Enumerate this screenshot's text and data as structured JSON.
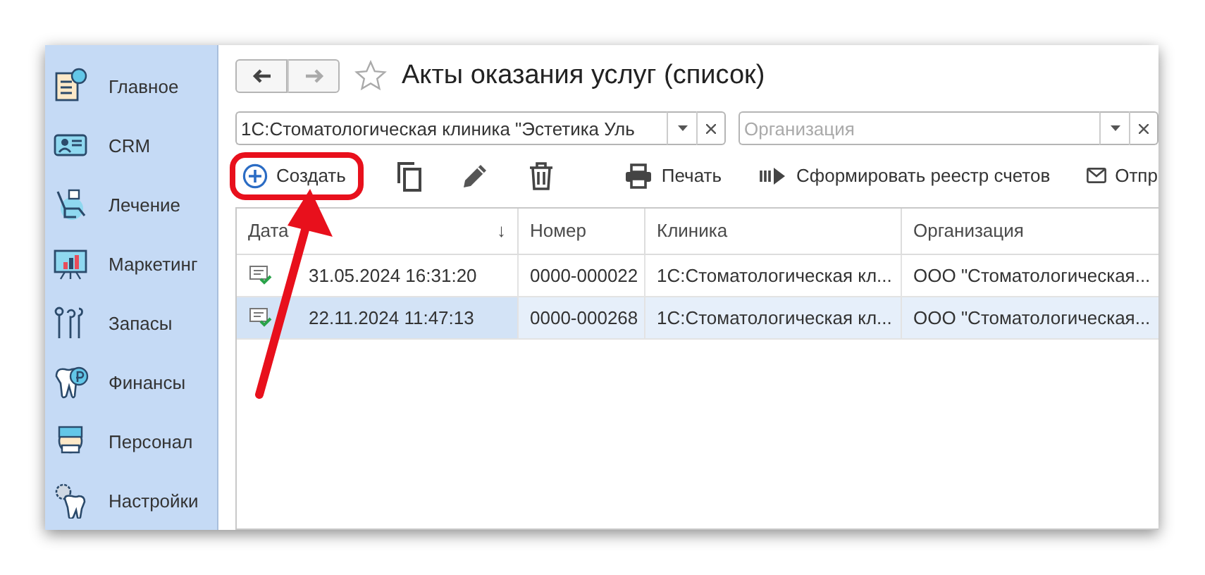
{
  "sidebar": {
    "items": [
      {
        "label": "Главное"
      },
      {
        "label": "CRM"
      },
      {
        "label": "Лечение"
      },
      {
        "label": "Маркетинг"
      },
      {
        "label": "Запасы"
      },
      {
        "label": "Финансы"
      },
      {
        "label": "Персонал"
      },
      {
        "label": "Настройки"
      }
    ]
  },
  "header": {
    "back": {
      "disabled": false
    },
    "forward": {
      "disabled": true
    },
    "favorite": false,
    "title": "Акты оказания услуг (список)"
  },
  "filters": [
    {
      "value": "1С:Стоматологическая клиника \"Эстетика Уль"
    },
    {
      "placeholder": "Организация"
    }
  ],
  "toolbar": [
    {
      "kind": "create",
      "label": "Создать",
      "highlighted": true
    },
    {
      "kind": "copy"
    },
    {
      "kind": "edit"
    },
    {
      "kind": "delete"
    },
    {
      "kind": "print",
      "label": "Печать"
    },
    {
      "kind": "registry",
      "label": "Сформировать реестр счетов"
    },
    {
      "kind": "mail",
      "label": "Отпр"
    }
  ],
  "table": {
    "columns": [
      {
        "label": "Дата",
        "sort": "↓"
      },
      {
        "label": "Номер"
      },
      {
        "label": "Клиника"
      },
      {
        "label": "Организация"
      }
    ],
    "rows": [
      {
        "selected": false,
        "cells": [
          "31.05.2024 16:31:20",
          "0000-000022",
          "1С:Стоматологическая кл...",
          "ООО \"Стоматологическая..."
        ]
      },
      {
        "selected": true,
        "cells": [
          "22.11.2024 11:47:13",
          "0000-000268",
          "1С:Стоматологическая кл...",
          "ООО \"Стоматологическая..."
        ]
      }
    ]
  }
}
